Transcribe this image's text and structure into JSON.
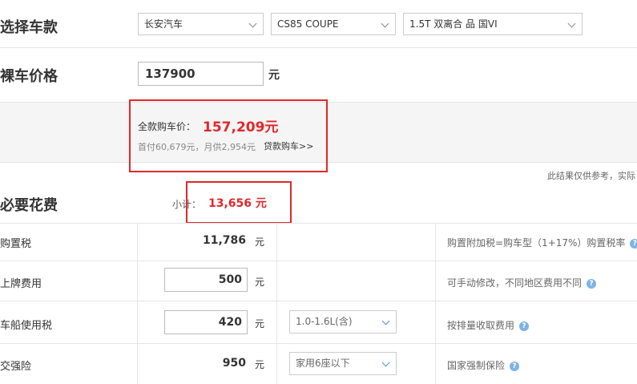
{
  "select_car": {
    "title": "选择车款",
    "brand": "长安汽车",
    "model": "CS85 COUPE",
    "trim": "1.5T 双离合 品 国VI"
  },
  "bare_price": {
    "title": "裸车价格",
    "value": "137900",
    "unit": "元"
  },
  "full_price": {
    "label": "全款购车价：",
    "value": "157,209元",
    "detail": "首付60,679元，月供2,954元",
    "loan_link": "贷款购车>>"
  },
  "disclaimer": "此结果仅供参考，实际",
  "required": {
    "title": "必要花费",
    "subtotal_label": "小计：",
    "subtotal_value": "13,656 元"
  },
  "rows": [
    {
      "label": "购置税",
      "value": "11,786",
      "unit": "元",
      "note": "购置附加税=购车型（1+17%）购置税率"
    },
    {
      "label": "上牌费用",
      "value": "500",
      "unit": "元",
      "note": "可手动修改，不同地区费用不同"
    },
    {
      "label": "车船使用税",
      "value": "420",
      "unit": "元",
      "select": "1.0-1.6L(含)",
      "note": "按排量收取费用"
    },
    {
      "label": "交强险",
      "value": "950",
      "unit": "元",
      "select": "家用6座以下",
      "note": "国家强制保险"
    }
  ],
  "colors": {
    "accent_red": "#e0282b",
    "help_blue": "#7fb2e6"
  }
}
